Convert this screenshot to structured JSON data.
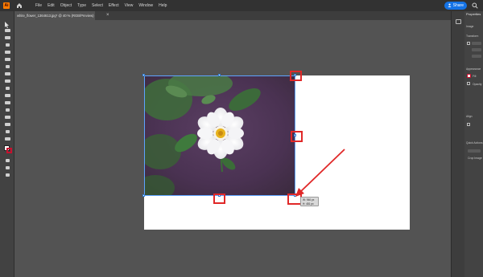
{
  "menubar": {
    "app_logo": "Ai",
    "items": [
      "File",
      "Edit",
      "Object",
      "Type",
      "Select",
      "Effect",
      "View",
      "Window",
      "Help"
    ],
    "share_label": "Share"
  },
  "document": {
    "tab_title": "white_flower_1364613.jpg* @ 40 % (RGB/Preview)",
    "tab_close": "×"
  },
  "canvas": {
    "tooltip_lines": [
      "W: 946 px",
      "H: 481 px"
    ]
  },
  "panel": {
    "tab_label": "Properties",
    "sections": [
      "Image",
      "Transform",
      "Appearance",
      "Align",
      "Quick Actions"
    ],
    "rows": [
      "Fill",
      "Opacity",
      "Crop Image"
    ]
  },
  "colors": {
    "menubar": "#323232",
    "workspace": "#535353",
    "accent": "#1473e6",
    "annotation": "#e02828",
    "selection": "#5da3ff"
  },
  "icons": [
    "home-icon",
    "search-icon",
    "user-icon",
    "selection-tool-icon",
    "close-icon",
    "properties-icon"
  ]
}
